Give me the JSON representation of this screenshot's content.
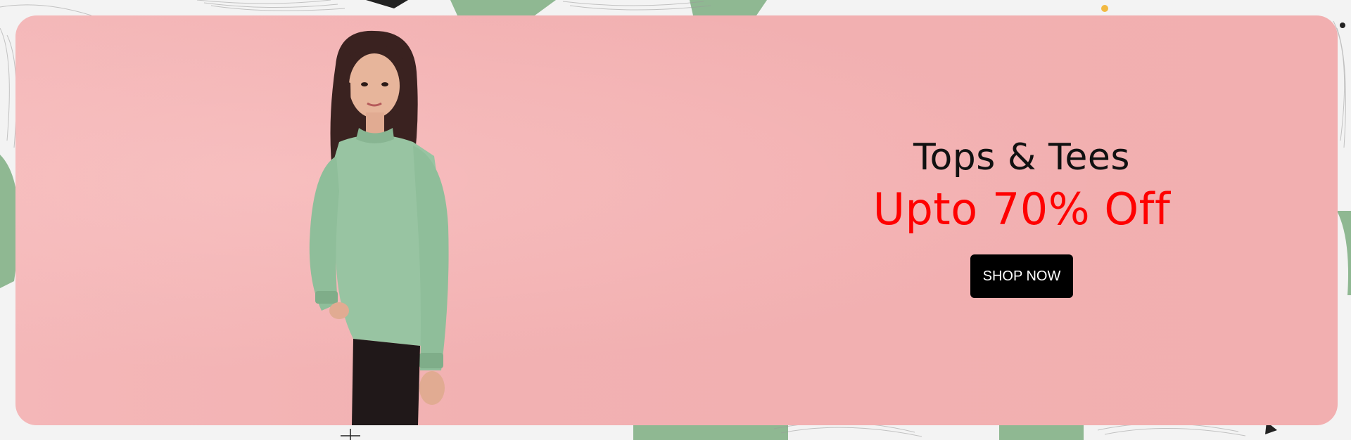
{
  "banner": {
    "title": "Tops & Tees",
    "offer": "Upto 70% Off",
    "cta_label": "SHOP NOW"
  },
  "colors": {
    "banner_pink": "#f2b1b2",
    "offer_red": "#ff0000",
    "button_black": "#000000",
    "top_green": "#98c4a2",
    "pattern_green": "#8fb892"
  }
}
